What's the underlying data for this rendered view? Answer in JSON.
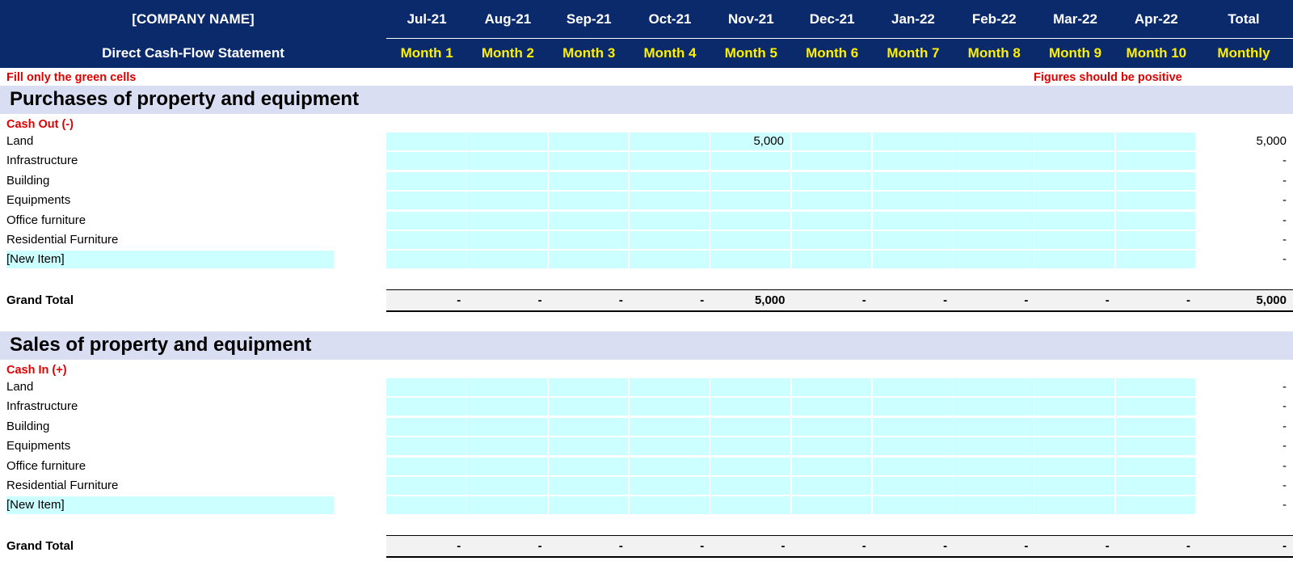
{
  "header": {
    "company": "[COMPANY NAME]",
    "subtitle": "Direct Cash-Flow Statement",
    "months": [
      "Jul-21",
      "Aug-21",
      "Sep-21",
      "Oct-21",
      "Nov-21",
      "Dec-21",
      "Jan-22",
      "Feb-22",
      "Mar-22",
      "Apr-22"
    ],
    "month_numbers": [
      "Month 1",
      "Month 2",
      "Month 3",
      "Month 4",
      "Month 5",
      "Month 6",
      "Month 7",
      "Month 8",
      "Month 9",
      "Month 10"
    ],
    "total_label": "Total",
    "total_sub": "Monthly"
  },
  "notes": {
    "left": "Fill only the green cells",
    "right": "Figures should be positive"
  },
  "sections": [
    {
      "title": "Purchases of property and equipment",
      "cash_label": "Cash Out (-)",
      "rows": [
        {
          "label": "Land",
          "values": [
            "",
            "",
            "",
            "",
            "5,000",
            "",
            "",
            "",
            "",
            ""
          ],
          "total": "5,000"
        },
        {
          "label": "Infrastructure",
          "values": [
            "",
            "",
            "",
            "",
            "",
            "",
            "",
            "",
            "",
            ""
          ],
          "total": "-"
        },
        {
          "label": "Building",
          "values": [
            "",
            "",
            "",
            "",
            "",
            "",
            "",
            "",
            "",
            ""
          ],
          "total": "-"
        },
        {
          "label": "Equipments",
          "values": [
            "",
            "",
            "",
            "",
            "",
            "",
            "",
            "",
            "",
            ""
          ],
          "total": "-"
        },
        {
          "label": "Office furniture",
          "values": [
            "",
            "",
            "",
            "",
            "",
            "",
            "",
            "",
            "",
            ""
          ],
          "total": "-"
        },
        {
          "label": "Residential Furniture",
          "values": [
            "",
            "",
            "",
            "",
            "",
            "",
            "",
            "",
            "",
            ""
          ],
          "total": "-"
        },
        {
          "label": "[New Item]",
          "values": [
            "",
            "",
            "",
            "",
            "",
            "",
            "",
            "",
            "",
            ""
          ],
          "total": "-"
        }
      ],
      "grand_total_label": "Grand Total",
      "grand_totals": [
        "-",
        "-",
        "-",
        "-",
        "5,000",
        "-",
        "-",
        "-",
        "-",
        "-"
      ],
      "grand_total_sum": "5,000"
    },
    {
      "title": "Sales of property and equipment",
      "cash_label": "Cash In (+)",
      "rows": [
        {
          "label": "Land",
          "values": [
            "",
            "",
            "",
            "",
            "",
            "",
            "",
            "",
            "",
            ""
          ],
          "total": "-"
        },
        {
          "label": "Infrastructure",
          "values": [
            "",
            "",
            "",
            "",
            "",
            "",
            "",
            "",
            "",
            ""
          ],
          "total": "-"
        },
        {
          "label": "Building",
          "values": [
            "",
            "",
            "",
            "",
            "",
            "",
            "",
            "",
            "",
            ""
          ],
          "total": "-"
        },
        {
          "label": "Equipments",
          "values": [
            "",
            "",
            "",
            "",
            "",
            "",
            "",
            "",
            "",
            ""
          ],
          "total": "-"
        },
        {
          "label": "Office furniture",
          "values": [
            "",
            "",
            "",
            "",
            "",
            "",
            "",
            "",
            "",
            ""
          ],
          "total": "-"
        },
        {
          "label": "Residential Furniture",
          "values": [
            "",
            "",
            "",
            "",
            "",
            "",
            "",
            "",
            "",
            ""
          ],
          "total": "-"
        },
        {
          "label": "[New Item]",
          "values": [
            "",
            "",
            "",
            "",
            "",
            "",
            "",
            "",
            "",
            ""
          ],
          "total": "-"
        }
      ],
      "grand_total_label": "Grand Total",
      "grand_totals": [
        "-",
        "-",
        "-",
        "-",
        "-",
        "-",
        "-",
        "-",
        "-",
        "-"
      ],
      "grand_total_sum": "-"
    }
  ],
  "colors": {
    "header_bg": "#0a2a6b",
    "month_sub": "#ffef00",
    "input_cell": "#ccffff",
    "section_band": "#d9def2",
    "note_red": "#e00000"
  }
}
